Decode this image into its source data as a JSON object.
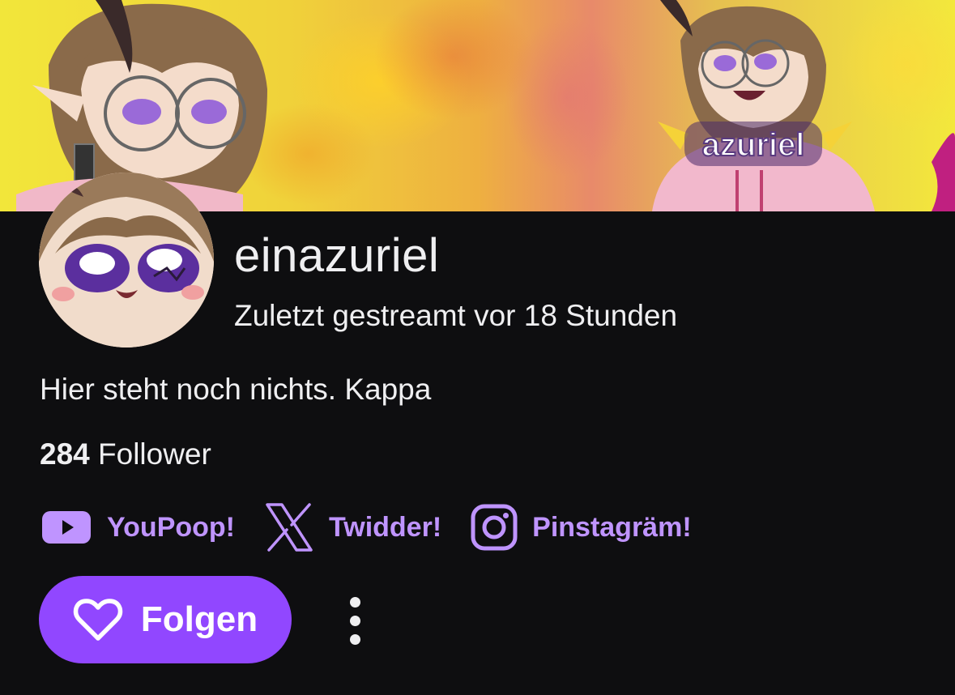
{
  "banner": {
    "logo_text": "azuriel",
    "icon": "anime-character-banner"
  },
  "profile": {
    "avatar_icon": "chibi-face-avatar",
    "name": "einazuriel",
    "last_streamed": "Zuletzt gestreamt vor 18 Stunden",
    "bio": "Hier steht noch nichts. Kappa",
    "follower_count": "284",
    "follower_label": "Follower"
  },
  "socials": [
    {
      "label": "YouPoop!",
      "icon": "youtube-icon"
    },
    {
      "label": "Twidder!",
      "icon": "x-twitter-icon"
    },
    {
      "label": "Pinstagräm!",
      "icon": "instagram-icon"
    }
  ],
  "actions": {
    "follow_label": "Folgen",
    "follow_icon": "heart-icon",
    "more_icon": "more-vertical-icon"
  },
  "colors": {
    "background": "#0e0e10",
    "accent": "#9147ff",
    "link": "#bf94ff",
    "text": "#efeff1"
  }
}
